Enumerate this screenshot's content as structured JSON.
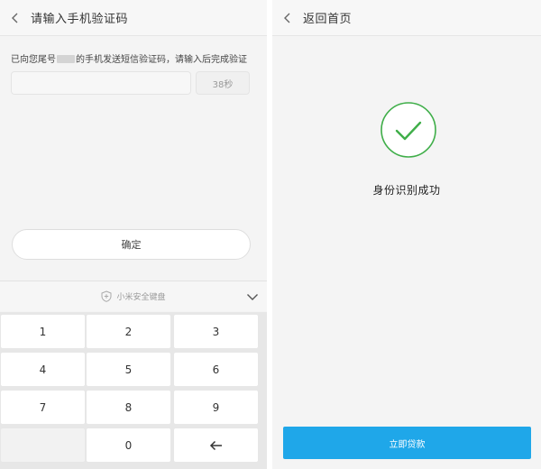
{
  "left_screen": {
    "title": "请输入手机验证码",
    "prompt_before": "已向您尾号",
    "prompt_after": "的手机发送短信验证码，请输入后完成验证",
    "code_value": "",
    "countdown": "38秒",
    "confirm_label": "确定",
    "keyboard_label": "小米安全键盘",
    "keys": [
      "1",
      "2",
      "3",
      "4",
      "5",
      "6",
      "7",
      "8",
      "9",
      "",
      "0",
      "←"
    ]
  },
  "right_screen": {
    "title": "返回首页",
    "status": "身份识别成功",
    "loan_label": "立即贷款"
  },
  "colors": {
    "success_green": "#3fae49",
    "primary_blue": "#1fa7e9"
  },
  "icons": {
    "back": "chevron-left-icon",
    "keyboard_shield": "shield-plus-icon",
    "collapse": "chevron-down-icon",
    "success": "checkmark-circle-icon",
    "backspace": "arrow-left-icon"
  }
}
